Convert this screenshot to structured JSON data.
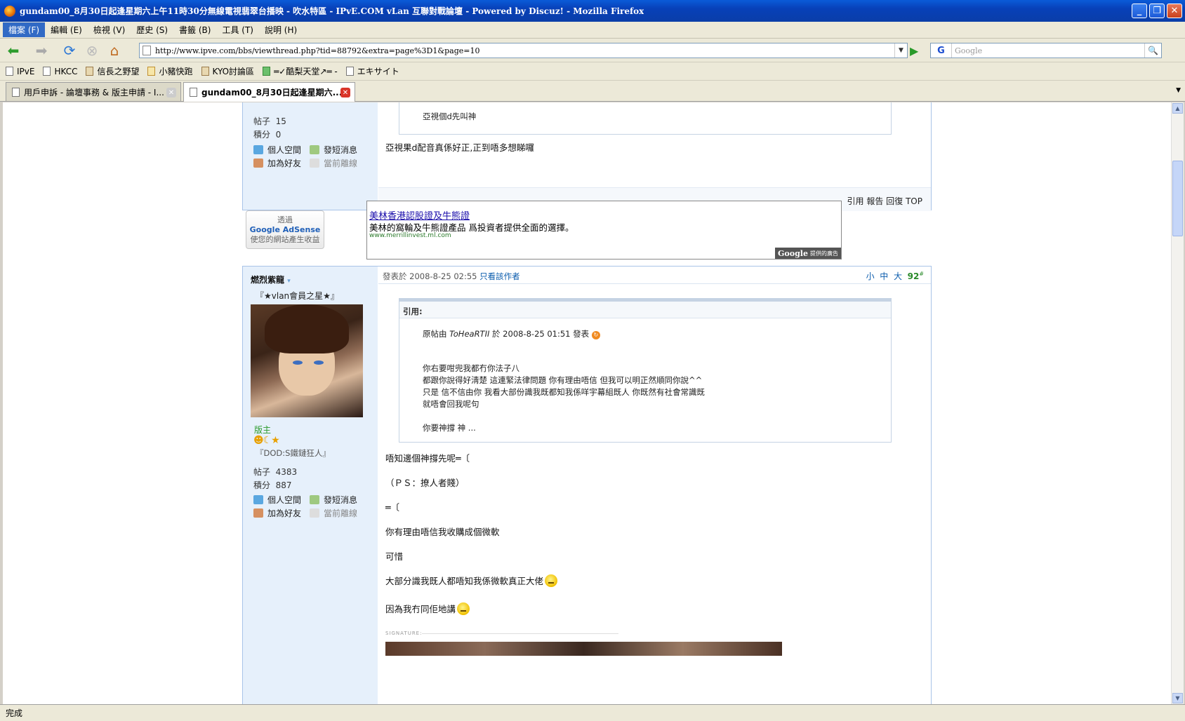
{
  "window": {
    "title": "gundam00_8月30日起逢星期六上午11時30分無線電視翡翠台播映 - 吹水特區 - IPvE.COM vLan 互聯對戰論壇 - Powered by Discuz! - Mozilla Firefox"
  },
  "menu": [
    "檔案 (F)",
    "編輯 (E)",
    "檢視 (V)",
    "歷史 (S)",
    "書籤 (B)",
    "工具 (T)",
    "說明 (H)"
  ],
  "nav": {
    "url": "http://www.ipve.com/bbs/viewthread.php?tid=88792&extra=page%3D1&page=10",
    "search_placeholder": "Google",
    "search_engine": "G"
  },
  "bookmarks": [
    "IPvE",
    "HKCC",
    "信長之野望",
    "小豬快跑",
    "KYO討論區",
    "═✓酷梨天堂↗═ -",
    "エキサイト"
  ],
  "tabs": [
    "用戶申訴 - 論壇事務 & 版主申請 - I...",
    "gundam00_8月30日起逢星期六..."
  ],
  "status": "完成",
  "post1": {
    "posts_label": "帖子",
    "posts": "15",
    "points_label": "積分",
    "points": "0",
    "home": "個人空間",
    "msg": "發短消息",
    "friend": "加為好友",
    "offline": "當前離線",
    "quote_tail": "亞視個d先叫神",
    "body": "亞視果d配音真係好正,正到唔多想睇囉",
    "footer": "引用 報告 回復 TOP"
  },
  "adsense": {
    "btn_line1": "透過",
    "btn_line2": "Google AdSense",
    "btn_line3": "使您的網站產生收益",
    "ad_title": "美林香港認股證及牛熊證",
    "ad_desc": "美林的窩輪及牛熊證產品 爲投資者提供全面的選擇。",
    "ad_url": "www.merrillinvest.ml.com",
    "ad_badge": "Google",
    "ad_badge_sub": "提供的廣告"
  },
  "post2": {
    "author": "燃烈紫龍",
    "subtitle": "『★vlan會員之星★』",
    "group": "版主",
    "custom_title": "『DOD:S鐵鏈狂人』",
    "posts_label": "帖子",
    "posts": "4383",
    "points_label": "積分",
    "points": "887",
    "home": "個人空間",
    "msg": "發短消息",
    "friend": "加為好友",
    "offline": "當前離線",
    "posted": "發表於 2008-8-25 02:55",
    "only_author": "只看該作者",
    "font_small": "小",
    "font_mid": "中",
    "font_big": "大",
    "floor": "92",
    "quote_label": "引用:",
    "quote_header_pre": "原帖由 ",
    "quote_author": "ToHeaRTII",
    "quote_header_post": " 於 2008-8-25 01:51 發表",
    "quote_lines": [
      "你右要咁兜我都冇你法子八",
      "都跟你說得好淸楚 這連緊法律問題 你有理由唔信 但我可以明正然順同你說^^",
      "只是 信不信由你 我看大部份識我既都知我係咩宇幕組既人 你既然有社會常識既",
      "就唔會回我呢句"
    ],
    "quote_last": "你要神撐 神 ...",
    "lines": [
      "唔知邊個神撐先呢═〔",
      "（ＰＳ：撩人者賤）",
      "═〔",
      "你有理由唔信我收購成個微軟",
      "可惜",
      "大部分識我既人都唔知我係微軟真正大佬",
      "因為我冇同佢地講"
    ],
    "signature": "SIGNATURE"
  }
}
